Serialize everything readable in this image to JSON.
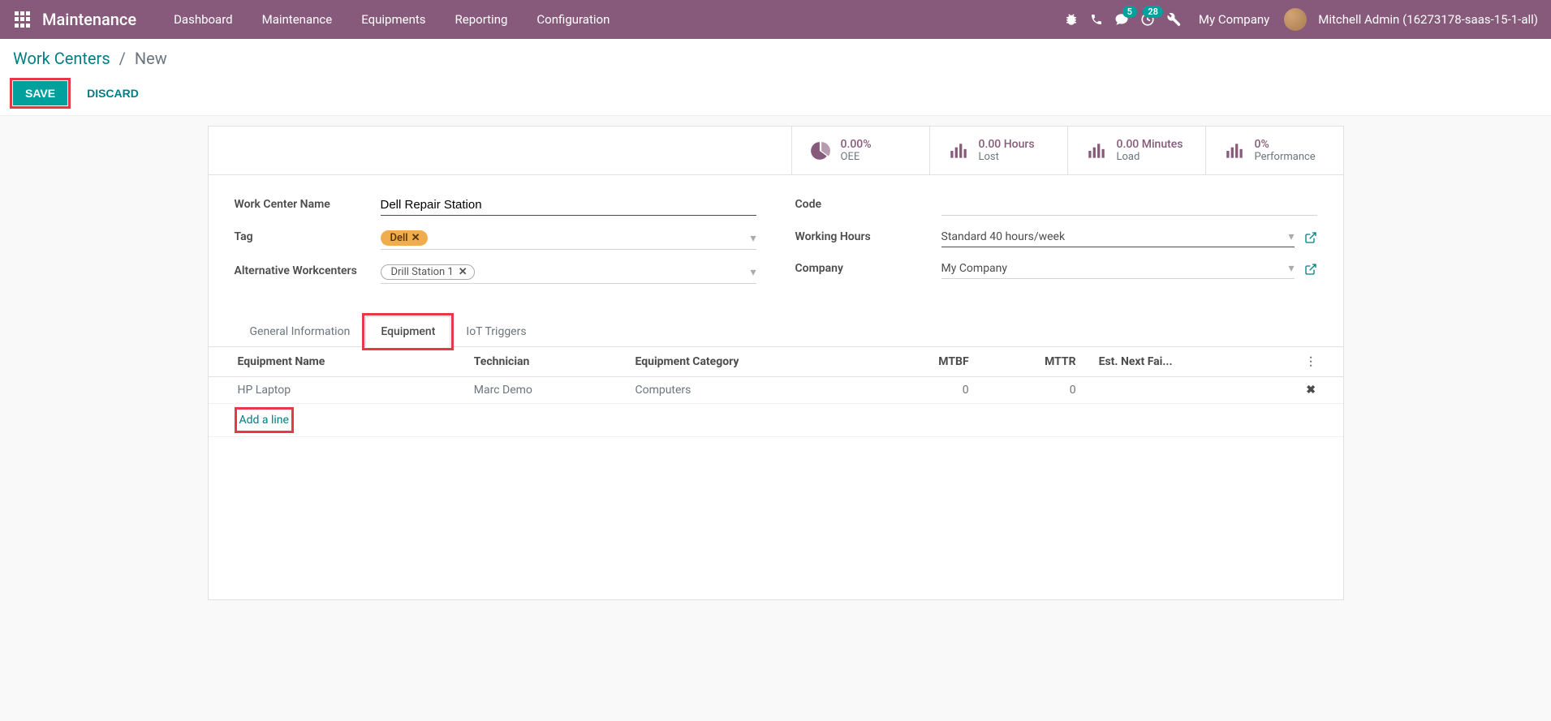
{
  "header": {
    "app_title": "Maintenance",
    "menu": [
      "Dashboard",
      "Maintenance",
      "Equipments",
      "Reporting",
      "Configuration"
    ],
    "messaging_badge": "5",
    "activities_badge": "28",
    "company": "My Company",
    "user": "Mitchell Admin (16273178-saas-15-1-all)"
  },
  "breadcrumb": {
    "root": "Work Centers",
    "current": "New"
  },
  "actions": {
    "save": "SAVE",
    "discard": "DISCARD"
  },
  "stats": {
    "oee": {
      "value": "0.00%",
      "label": "OEE"
    },
    "lost": {
      "value": "0.00 Hours",
      "label": "Lost"
    },
    "load": {
      "value": "0.00 Minutes",
      "label": "Load"
    },
    "perf": {
      "value": "0%",
      "label": "Performance"
    }
  },
  "fields": {
    "name_label": "Work Center Name",
    "name_value": "Dell Repair Station",
    "tag_label": "Tag",
    "tags": [
      "Dell"
    ],
    "alt_label": "Alternative Workcenters",
    "alt_value": "Drill Station 1",
    "code_label": "Code",
    "code_value": "",
    "hours_label": "Working Hours",
    "hours_value": "Standard 40 hours/week",
    "company_label": "Company",
    "company_value": "My Company"
  },
  "tabs": [
    "General Information",
    "Equipment",
    "IoT Triggers"
  ],
  "table": {
    "headers": {
      "name": "Equipment Name",
      "tech": "Technician",
      "cat": "Equipment Category",
      "mtbf": "MTBF",
      "mttr": "MTTR",
      "next": "Est. Next Fai..."
    },
    "row": {
      "name": "HP Laptop",
      "tech": "Marc Demo",
      "cat": "Computers",
      "mtbf": "0",
      "mttr": "0",
      "next": ""
    },
    "add_line": "Add a line"
  }
}
